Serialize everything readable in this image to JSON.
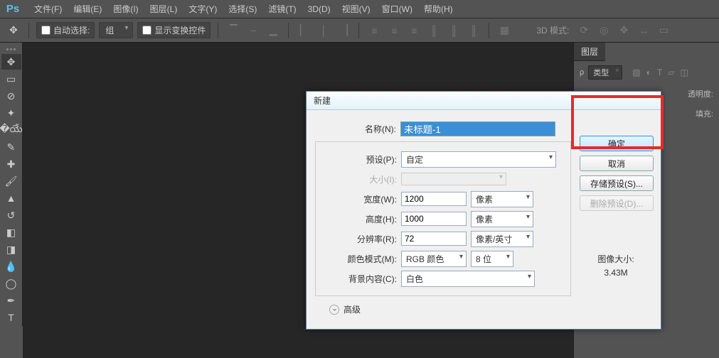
{
  "menubar": {
    "items": [
      "文件(F)",
      "编辑(E)",
      "图像(I)",
      "图层(L)",
      "文字(Y)",
      "选择(S)",
      "滤镜(T)",
      "3D(D)",
      "视图(V)",
      "窗口(W)",
      "帮助(H)"
    ]
  },
  "optionsbar": {
    "auto_select": "自动选择:",
    "group": "组",
    "show_transform": "显示变换控件",
    "mode3d": "3D 模式:"
  },
  "rightpanel": {
    "tab_layers": "图层",
    "kind": "类型",
    "opacity_label": "透明度:",
    "fill_label": "填充:"
  },
  "dialog": {
    "title": "新建",
    "name_label": "名称(N):",
    "name_value": "未标题-1",
    "preset_label": "预设(P):",
    "preset_value": "自定",
    "size_label": "大小(I):",
    "width_label": "宽度(W):",
    "width_value": "1200",
    "width_unit": "像素",
    "height_label": "高度(H):",
    "height_value": "1000",
    "height_unit": "像素",
    "res_label": "分辨率(R):",
    "res_value": "72",
    "res_unit": "像素/英寸",
    "mode_label": "颜色模式(M):",
    "mode_value": "RGB 颜色",
    "mode_depth": "8 位",
    "bg_label": "背景内容(C):",
    "bg_value": "白色",
    "advanced": "高级",
    "ok": "确定",
    "cancel": "取消",
    "save_preset": "存储预设(S)...",
    "del_preset": "删除预设(D)...",
    "img_size_label": "图像大小:",
    "img_size_value": "3.43M"
  }
}
